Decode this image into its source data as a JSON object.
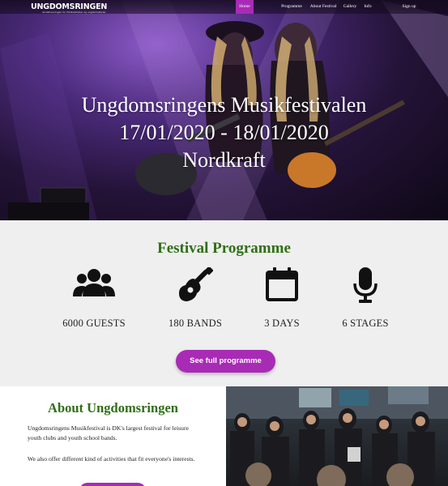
{
  "nav": {
    "logo": "UNGDOMSRINGEN",
    "logo_sub": "landsforeningen for fritidsklubber og ungdomsskoler",
    "items": [
      {
        "label": "Home",
        "active": true
      },
      {
        "label": "Programme",
        "active": false
      },
      {
        "label": "About Festival",
        "active": false
      },
      {
        "label": "Gallery",
        "active": false
      },
      {
        "label": "Info",
        "active": false
      }
    ],
    "signup": "Sign up"
  },
  "hero": {
    "line1": "Ungdomsringens Musikfestivalen",
    "line2": "17/01/2020 - 18/01/2020",
    "line3": "Nordkraft"
  },
  "programme": {
    "title": "Festival Programme",
    "stats": [
      {
        "icon": "users-icon",
        "label": "6000 GUESTS"
      },
      {
        "icon": "guitar-icon",
        "label": "180 BANDS"
      },
      {
        "icon": "calendar-icon",
        "label": "3 DAYS"
      },
      {
        "icon": "microphone-icon",
        "label": "6 STAGES"
      }
    ],
    "button": "See full programme"
  },
  "about": {
    "title": "About Ungdomsringen",
    "p1": "Ungdomsringens Musikfestival is DK's largest festival for leisure youth clubs and youth school bands.",
    "p2": "We also offer different kind of activities that fit everyone's interests."
  },
  "colors": {
    "accent": "#a82bb5",
    "heading_green": "#2f6f17",
    "section_bg": "#efefef"
  }
}
